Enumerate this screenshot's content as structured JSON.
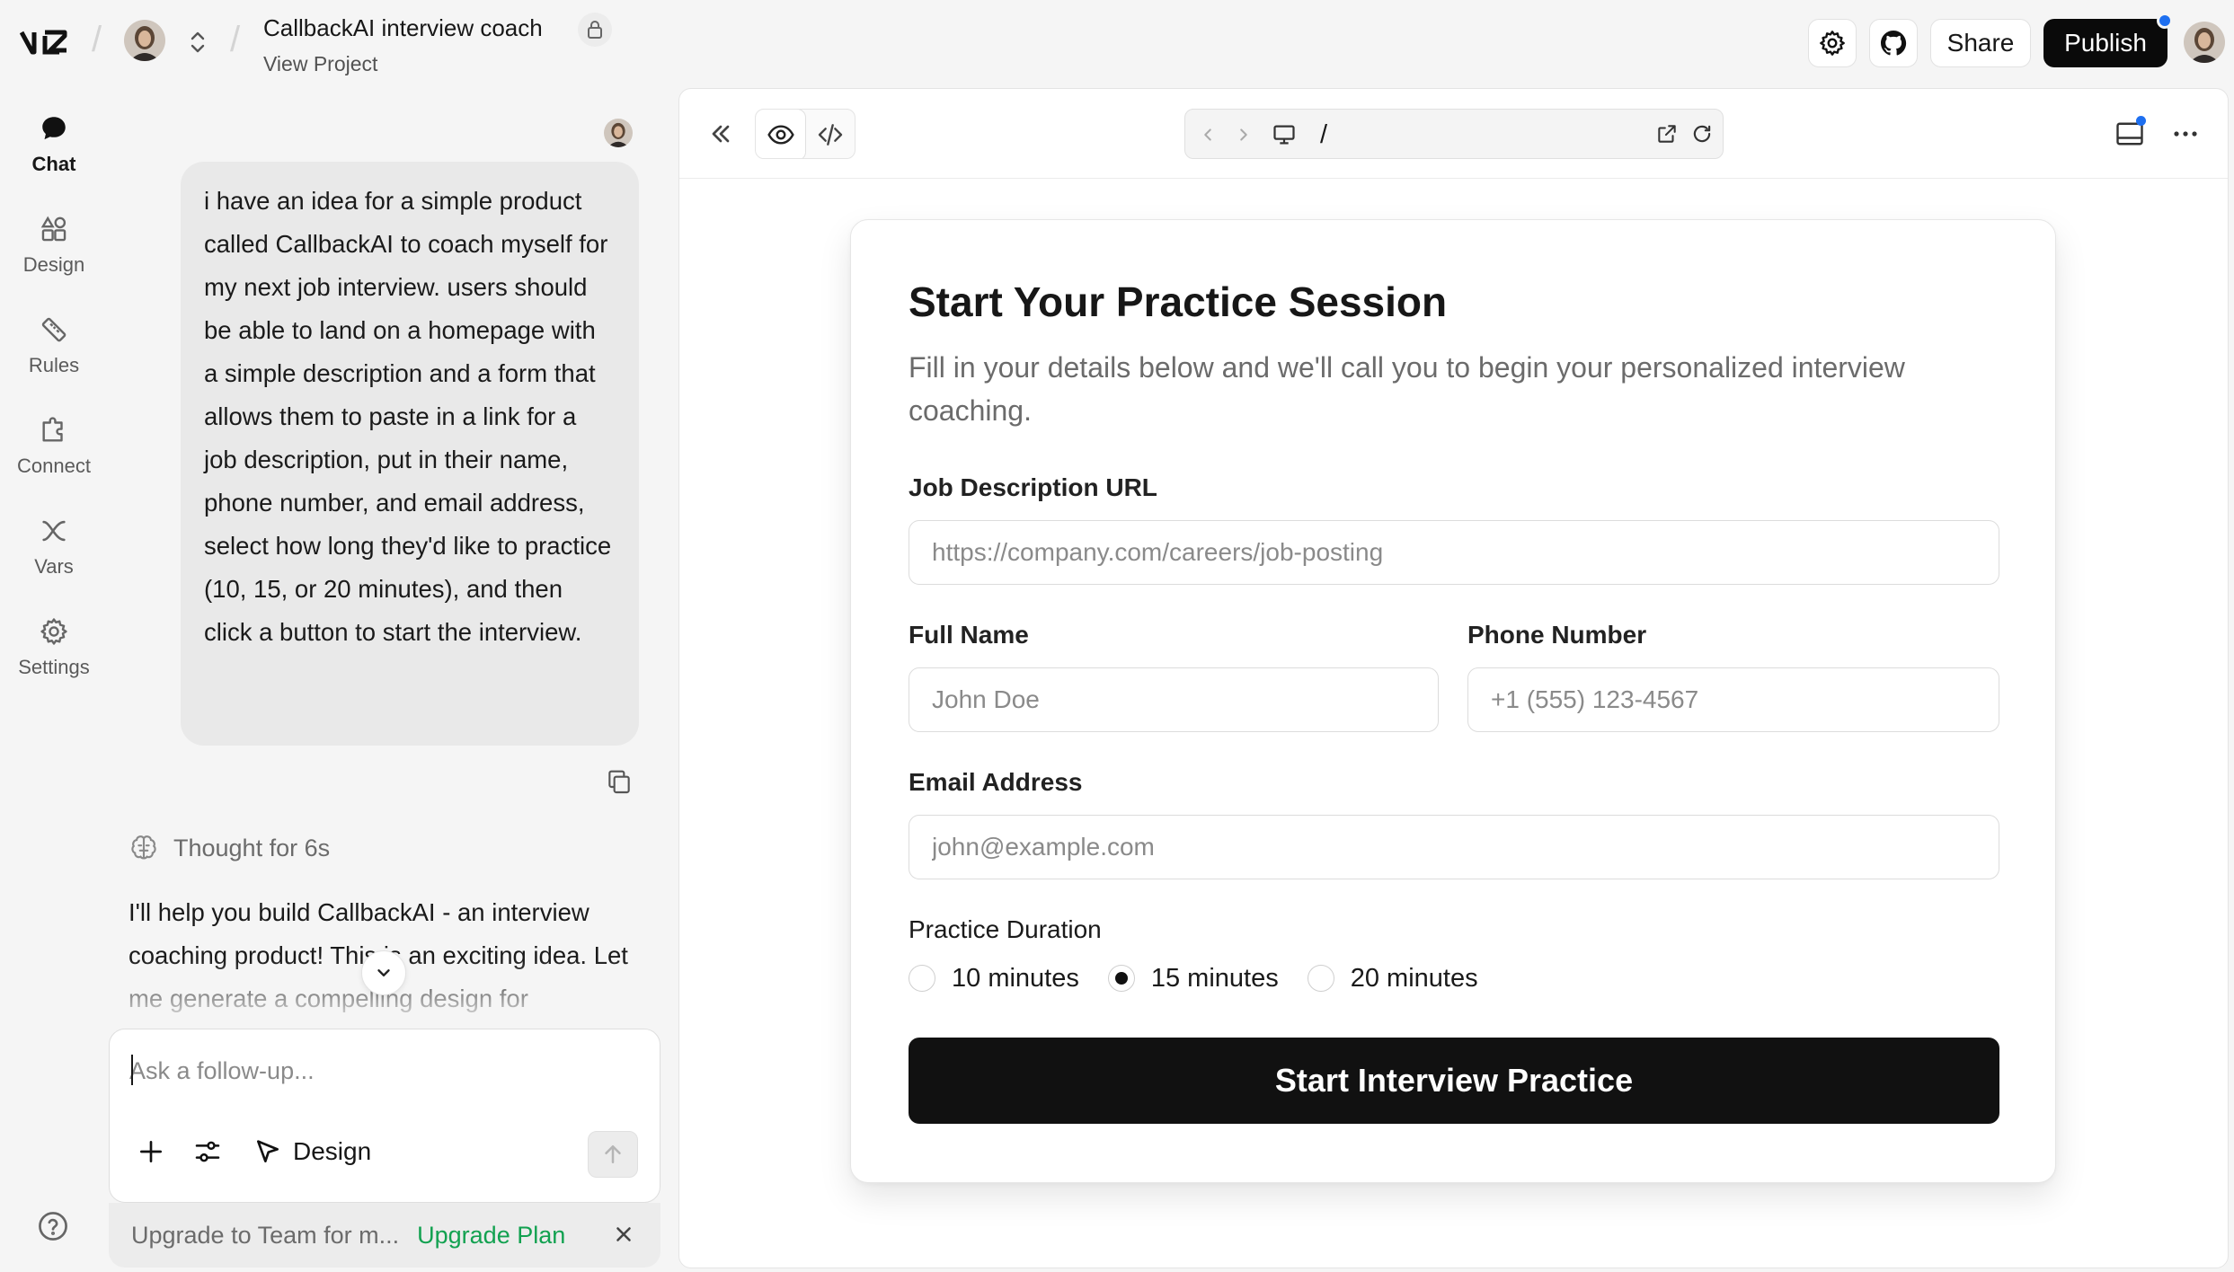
{
  "header": {
    "project_title": "CallbackAI interview coach",
    "view_project": "View Project",
    "share_label": "Share",
    "publish_label": "Publish"
  },
  "rail": {
    "items": [
      {
        "label": "Chat",
        "icon": "chat-bubble-icon",
        "active": true
      },
      {
        "label": "Design",
        "icon": "design-shapes-icon"
      },
      {
        "label": "Rules",
        "icon": "ruler-icon"
      },
      {
        "label": "Connect",
        "icon": "puzzle-icon"
      },
      {
        "label": "Vars",
        "icon": "variable-icon"
      },
      {
        "label": "Settings",
        "icon": "gear-icon"
      }
    ]
  },
  "chat": {
    "user_message": "i have an idea for a simple product called CallbackAI to coach myself for my next job interview. users should be able to land on a homepage with a simple description and a form that allows them to paste in a link for a job description, put in their name, phone number, and email address, select how long they'd like to practice (10, 15, or 20 minutes), and then click a button to start the interview.",
    "thought_label": "Thought for 6s",
    "assistant_message": "I'll help you build CallbackAI - an interview coaching product! This is an exciting idea. Let me generate a compelling design for",
    "composer_placeholder": "Ask a follow-up...",
    "design_label": "Design",
    "upgrade_text": "Upgrade to Team for m...",
    "upgrade_link": "Upgrade Plan"
  },
  "preview": {
    "url_path": "/",
    "form": {
      "title": "Start Your Practice Session",
      "description": "Fill in your details below and we'll call you to begin your personalized interview coaching.",
      "job_url_label": "Job Description URL",
      "job_url_placeholder": "https://company.com/careers/job-posting",
      "name_label": "Full Name",
      "name_placeholder": "John Doe",
      "phone_label": "Phone Number",
      "phone_placeholder": "+1 (555) 123-4567",
      "email_label": "Email Address",
      "email_placeholder": "john@example.com",
      "duration_label": "Practice Duration",
      "duration_options": [
        "10 minutes",
        "15 minutes",
        "20 minutes"
      ],
      "duration_selected": "15 minutes",
      "submit_label": "Start Interview Practice"
    }
  },
  "colors": {
    "accent_green": "#12a150",
    "notification_blue": "#1e6ff0",
    "primary_dark": "#111111"
  }
}
